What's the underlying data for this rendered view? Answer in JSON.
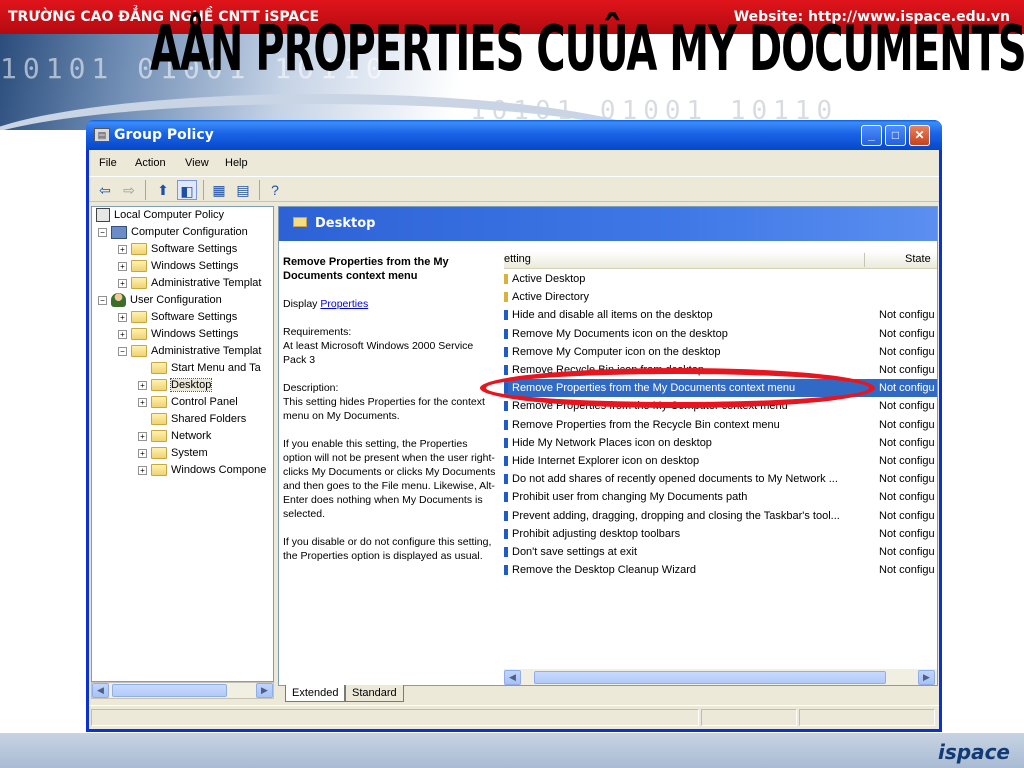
{
  "slide": {
    "school": "TRƯỜNG CAO ĐẲNG NGHỀ CNTT iSPACE",
    "website": "Website: http://www.ispace.edu.vn",
    "title": "AÅN PROPERTIES CUÛA MY DOCUMENTS",
    "footer_logo": "ispace",
    "banner_binary": "10101 01001 10110"
  },
  "window": {
    "title": "Group Policy",
    "app_icon": "group-policy-icon",
    "controls": [
      "minimize",
      "maximize",
      "close"
    ]
  },
  "menu": [
    "File",
    "Action",
    "View",
    "Help"
  ],
  "tree": {
    "items": [
      {
        "label": "Local Computer Policy",
        "icon": "policy"
      },
      {
        "label": "Computer Configuration",
        "icon": "computer"
      },
      {
        "label": "Software Settings",
        "icon": "folder"
      },
      {
        "label": "Windows Settings",
        "icon": "folder"
      },
      {
        "label": "Administrative Templat",
        "icon": "folder"
      },
      {
        "label": "User Configuration",
        "icon": "user"
      },
      {
        "label": "Software Settings",
        "icon": "folder"
      },
      {
        "label": "Windows Settings",
        "icon": "folder"
      },
      {
        "label": "Administrative Templat",
        "icon": "folder"
      },
      {
        "label": "Start Menu and Ta",
        "icon": "folder"
      },
      {
        "label": "Desktop",
        "icon": "folder",
        "selected": true
      },
      {
        "label": "Control Panel",
        "icon": "folder"
      },
      {
        "label": "Shared Folders",
        "icon": "folder"
      },
      {
        "label": "Network",
        "icon": "folder"
      },
      {
        "label": "System",
        "icon": "folder"
      },
      {
        "label": "Windows Compone",
        "icon": "folder"
      }
    ]
  },
  "pane": {
    "header": "Desktop",
    "description": {
      "title": "Remove Properties from the My Documents context menu",
      "display_prefix": "Display",
      "display_link": "Properties",
      "requirements_label": "Requirements:",
      "requirements": "At least Microsoft Windows 2000 Service Pack 3",
      "description_label": "Description:",
      "description": "This setting hides Properties for the context menu on My Documents.",
      "if_enable": "If you enable this setting, the Properties option will not be present when the user right-clicks My Documents or clicks My Documents and then goes to the File menu.  Likewise, Alt-Enter does nothing when My Documents is selected.",
      "if_disable": "If you disable or do not configure this setting, the Properties option is displayed as usual."
    },
    "columns": {
      "setting": "etting",
      "state": "State"
    },
    "rows": [
      {
        "setting": "Active Desktop",
        "state": "",
        "icon": "folder"
      },
      {
        "setting": "Active Directory",
        "state": "",
        "icon": "folder"
      },
      {
        "setting": "Hide and disable all items on the desktop",
        "state": "Not configu",
        "icon": "policy"
      },
      {
        "setting": "Remove My Documents icon on the desktop",
        "state": "Not configu",
        "icon": "policy"
      },
      {
        "setting": "Remove My Computer icon on the desktop",
        "state": "Not configu",
        "icon": "policy"
      },
      {
        "setting": "Remove Recycle Bin icon from desktop",
        "state": "Not configu",
        "icon": "policy"
      },
      {
        "setting": "Remove Properties from the My Documents context menu",
        "state": "Not configu",
        "icon": "policy",
        "selected": true
      },
      {
        "setting": "Remove Properties from the My Computer context menu",
        "state": "Not configu",
        "icon": "policy"
      },
      {
        "setting": "Remove Properties from the Recycle Bin context menu",
        "state": "Not configu",
        "icon": "policy"
      },
      {
        "setting": "Hide My Network Places icon on desktop",
        "state": "Not configu",
        "icon": "policy"
      },
      {
        "setting": "Hide Internet Explorer icon on desktop",
        "state": "Not configu",
        "icon": "policy"
      },
      {
        "setting": "Do not add shares of recently opened documents to My Network ...",
        "state": "Not configu",
        "icon": "policy"
      },
      {
        "setting": "Prohibit user from changing My Documents path",
        "state": "Not configu",
        "icon": "policy"
      },
      {
        "setting": "Prevent adding, dragging, dropping and closing the Taskbar's tool...",
        "state": "Not configu",
        "icon": "policy"
      },
      {
        "setting": "Prohibit adjusting desktop toolbars",
        "state": "Not configu",
        "icon": "policy"
      },
      {
        "setting": "Don't save settings at exit",
        "state": "Not configu",
        "icon": "policy"
      },
      {
        "setting": "Remove the Desktop Cleanup Wizard",
        "state": "Not configu",
        "icon": "policy"
      }
    ],
    "tabs": [
      "Extended",
      "Standard"
    ]
  },
  "colors": {
    "accent_red": "#e8141e",
    "selection": "#316ac5",
    "title_blue": "#0a5fe0"
  }
}
